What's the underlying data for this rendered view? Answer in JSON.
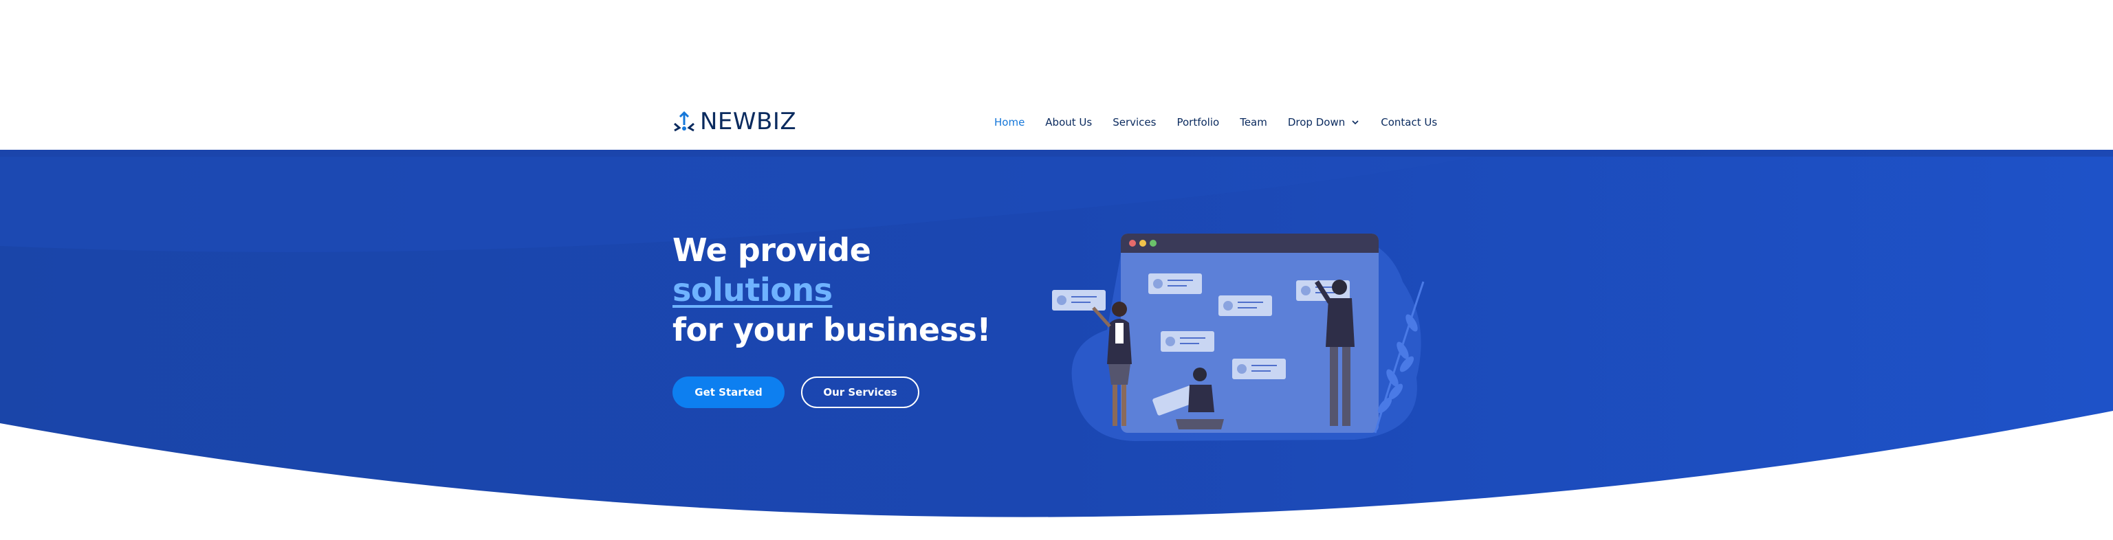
{
  "brand": {
    "name": "NEWBIZ",
    "icon": "logo-icon"
  },
  "nav": {
    "items": [
      {
        "label": "Home",
        "active": true
      },
      {
        "label": "About Us"
      },
      {
        "label": "Services"
      },
      {
        "label": "Portfolio"
      },
      {
        "label": "Team"
      },
      {
        "label": "Drop Down",
        "has_caret": true
      },
      {
        "label": "Contact Us"
      }
    ]
  },
  "hero": {
    "line1": "We provide",
    "accent": "solutions",
    "line3": "for your business!",
    "primary_cta": "Get Started",
    "secondary_cta": "Our Services"
  },
  "colors": {
    "hero_bg": "#1b48b4",
    "nav_text": "#0a2a5e",
    "nav_active": "#1577d9",
    "accent_text": "#6fb3ff",
    "primary_button": "#0d7ff0"
  }
}
